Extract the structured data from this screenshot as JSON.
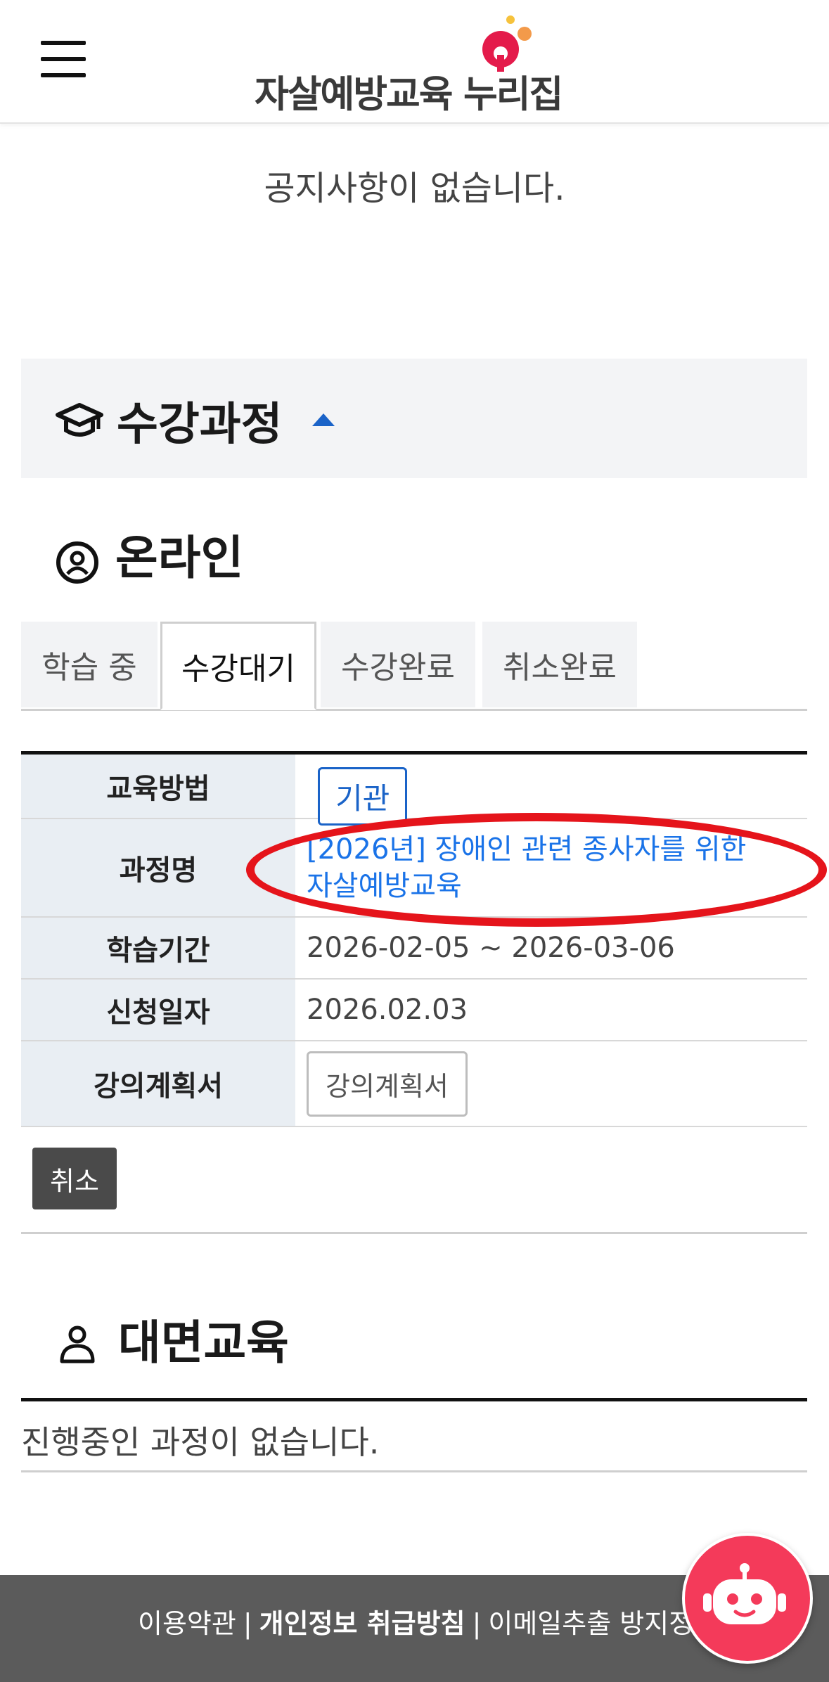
{
  "header": {
    "logo_text": "자살예방교육 누리집",
    "menu_icon": "hamburger-menu-icon"
  },
  "notice": {
    "empty_text": "공지사항이 없습니다."
  },
  "enrolled": {
    "title": "수강과정",
    "icon": "graduation-cap-icon"
  },
  "online": {
    "title": "온라인",
    "icon": "user-circle-icon",
    "tabs": [
      {
        "label": "학습 중"
      },
      {
        "label": "수강대기"
      },
      {
        "label": "수강완료"
      },
      {
        "label": "취소완료"
      }
    ],
    "active_tab": "수강대기",
    "table": {
      "method_label": "교육방법",
      "method_value": "기관",
      "course_label": "과정명",
      "course_value": "[2026년] 장애인 관련 종사자를 위한 자살예방교육",
      "period_label": "학습기간",
      "period_value": "2026-02-05 ~ 2026-03-06",
      "apply_label": "신청일자",
      "apply_value": "2026.02.03",
      "plan_label": "강의계획서",
      "plan_button": "강의계획서"
    },
    "cancel_button": "취소"
  },
  "offline": {
    "title": "대면교육",
    "icon": "person-icon",
    "empty_text": "진행중인 과정이 없습니다."
  },
  "footer": {
    "terms": "이용약관",
    "privacy": "개인정보 취급방침",
    "email_policy": "이메일추출 방지정책",
    "separator": "|",
    "chatbot_icon": "chatbot-robot-icon"
  },
  "colors": {
    "accent": "#1a63c8",
    "link": "#1a73e8",
    "footer_bg": "#5b5b5b",
    "chatbot": "#f43a5a",
    "annotation": "#e5141b"
  }
}
